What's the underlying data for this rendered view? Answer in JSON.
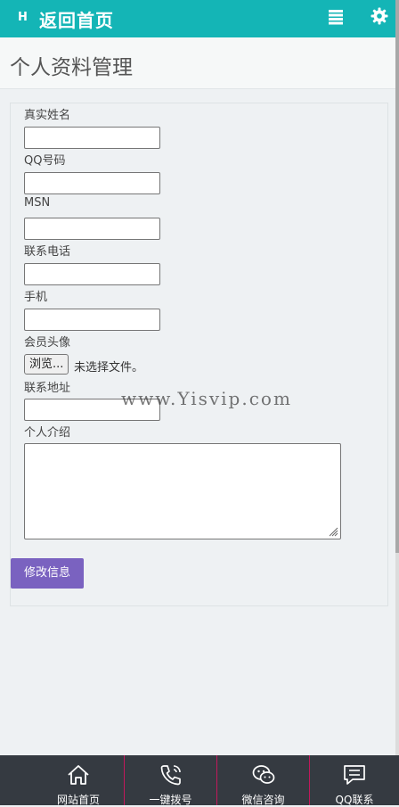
{
  "header": {
    "logo_text": "H",
    "home_label": "返回首页",
    "menu_icon": "list-icon",
    "settings_icon": "gear-icon",
    "accent_color": "#14b5b6"
  },
  "page": {
    "title": "个人资料管理"
  },
  "form": {
    "fields": [
      {
        "label": "真实姓名",
        "value": ""
      },
      {
        "label": "QQ号码",
        "value": ""
      },
      {
        "label": "MSN",
        "value": ""
      },
      {
        "label": "联系电话",
        "value": ""
      },
      {
        "label": "手机",
        "value": ""
      }
    ],
    "avatar": {
      "label": "会员头像",
      "button": "浏览...",
      "status": "未选择文件。"
    },
    "address": {
      "label": "联系地址",
      "value": ""
    },
    "intro": {
      "label": "个人介绍",
      "value": ""
    },
    "submit_label": "修改信息",
    "submit_color": "#7a62c0"
  },
  "watermark": "www.Yisvip.com",
  "bottom_nav": [
    {
      "label": "网站首页",
      "icon": "home-icon"
    },
    {
      "label": "一键拨号",
      "icon": "phone-icon"
    },
    {
      "label": "微信咨询",
      "icon": "wechat-icon"
    },
    {
      "label": "QQ联系",
      "icon": "message-icon"
    }
  ]
}
